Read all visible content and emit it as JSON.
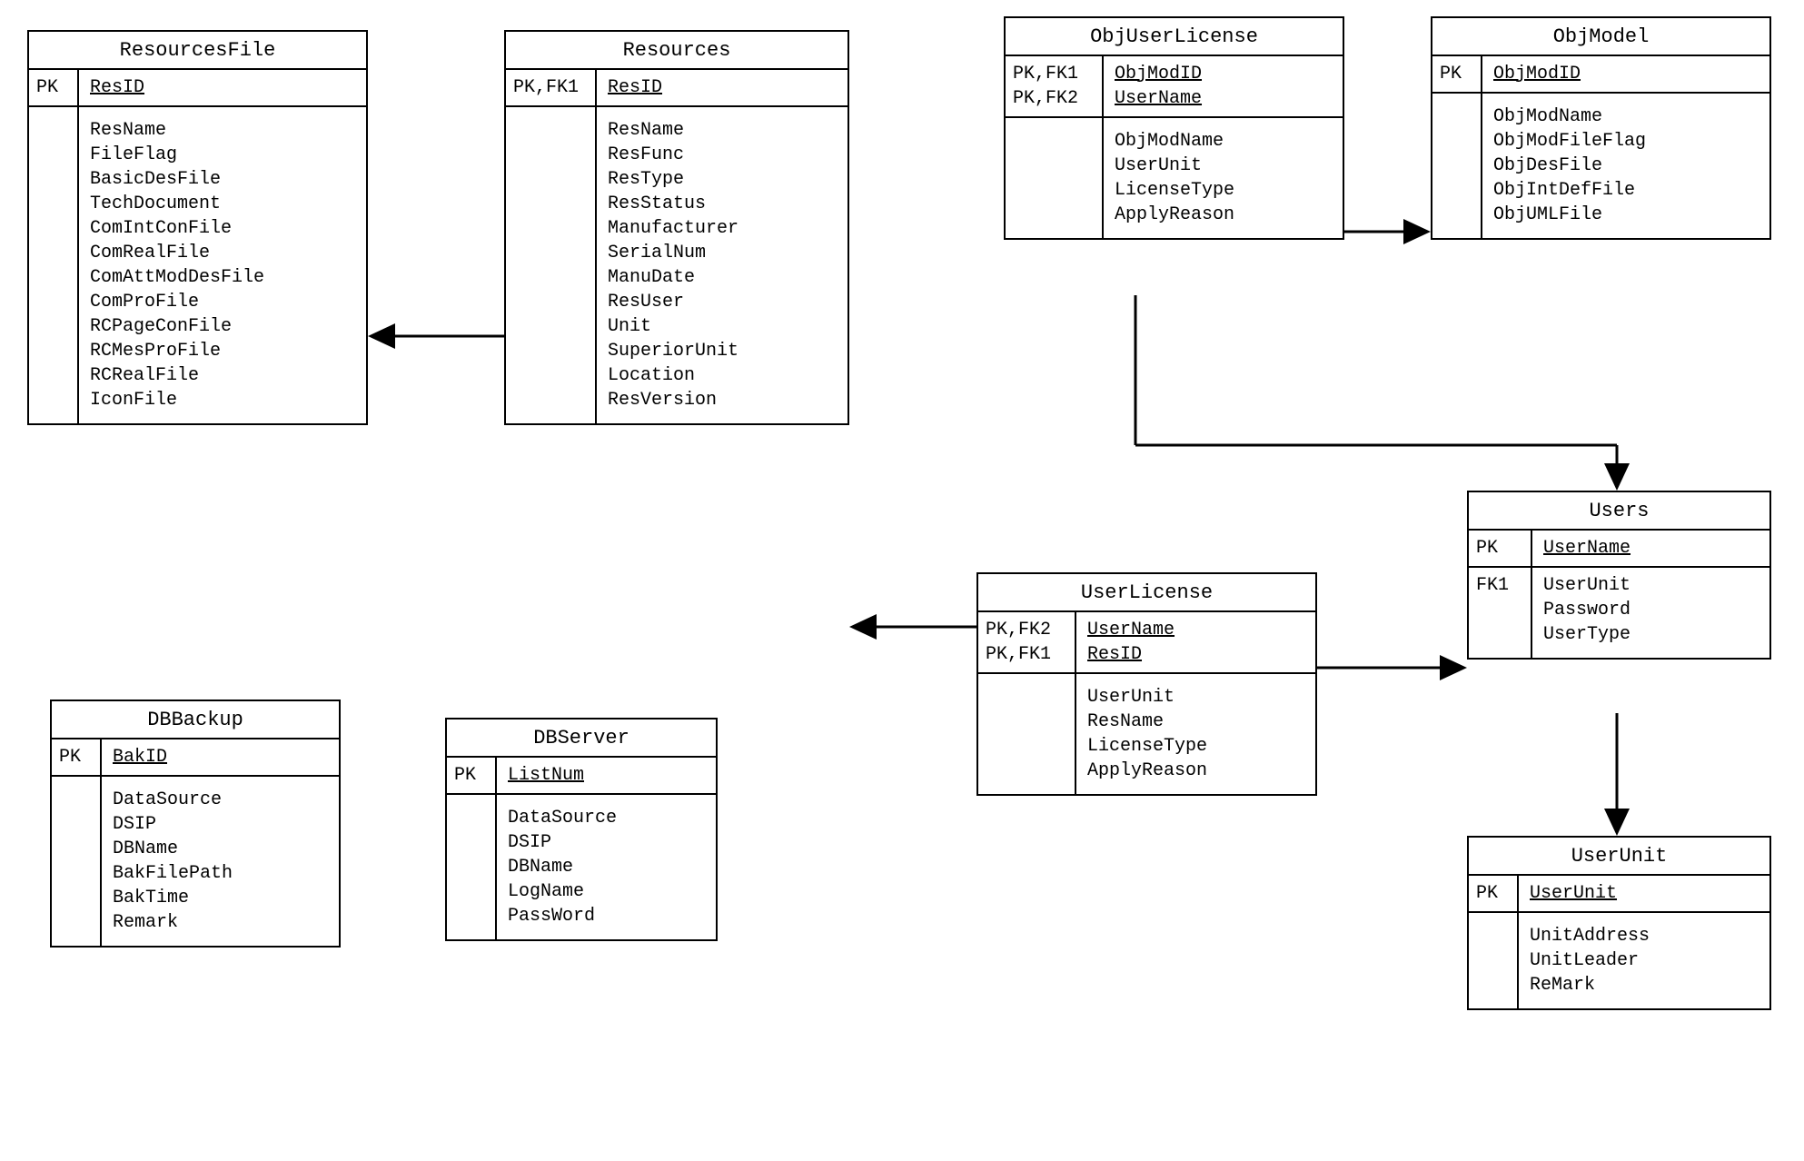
{
  "entities": {
    "ResourcesFile": {
      "title": "ResourcesFile",
      "pk_tags": [
        "PK"
      ],
      "pk_fields": [
        "ResID"
      ],
      "attrs": [
        "ResName",
        "FileFlag",
        "BasicDesFile",
        "TechDocument",
        "ComIntConFile",
        "ComRealFile",
        "ComAttModDesFile",
        "ComProFile",
        "RCPageConFile",
        "RCMesProFile",
        "RCRealFile",
        "IconFile"
      ]
    },
    "Resources": {
      "title": "Resources",
      "pk_tags": [
        "PK,FK1"
      ],
      "pk_fields": [
        "ResID"
      ],
      "attrs": [
        "ResName",
        "ResFunc",
        "ResType",
        "ResStatus",
        "Manufacturer",
        "SerialNum",
        "ManuDate",
        "ResUser",
        "Unit",
        "SuperiorUnit",
        "Location",
        "ResVersion"
      ]
    },
    "ObjUserLicense": {
      "title": "ObjUserLicense",
      "pk_tags": [
        "PK,FK1",
        "PK,FK2"
      ],
      "pk_fields": [
        "ObjModID",
        "UserName"
      ],
      "attrs": [
        "ObjModName",
        "UserUnit",
        "LicenseType",
        "ApplyReason"
      ]
    },
    "ObjModel": {
      "title": "ObjModel",
      "pk_tags": [
        "PK"
      ],
      "pk_fields": [
        "ObjModID"
      ],
      "attrs": [
        "ObjModName",
        "ObjModFileFlag",
        "ObjDesFile",
        "ObjIntDefFile",
        "ObjUMLFile"
      ]
    },
    "UserLicense": {
      "title": "UserLicense",
      "pk_tags": [
        "PK,FK2",
        "PK,FK1"
      ],
      "pk_fields": [
        "UserName",
        "ResID"
      ],
      "attrs": [
        "UserUnit",
        "ResName",
        "LicenseType",
        "ApplyReason"
      ]
    },
    "Users": {
      "title": "Users",
      "pk_tags": [
        "PK"
      ],
      "pk_fields": [
        "UserName"
      ],
      "fk_tags": [
        "FK1"
      ],
      "attrs": [
        "UserUnit",
        "Password",
        "UserType"
      ]
    },
    "UserUnit": {
      "title": "UserUnit",
      "pk_tags": [
        "PK"
      ],
      "pk_fields": [
        "UserUnit"
      ],
      "attrs": [
        "UnitAddress",
        "UnitLeader",
        "ReMark"
      ]
    },
    "DBBackup": {
      "title": "DBBackup",
      "pk_tags": [
        "PK"
      ],
      "pk_fields": [
        "BakID"
      ],
      "attrs": [
        "DataSource",
        "DSIP",
        "DBName",
        "BakFilePath",
        "BakTime",
        "Remark"
      ]
    },
    "DBServer": {
      "title": "DBServer",
      "pk_tags": [
        "PK"
      ],
      "pk_fields": [
        "ListNum"
      ],
      "attrs": [
        "DataSource",
        "DSIP",
        "DBName",
        "LogName",
        "PassWord"
      ]
    }
  },
  "relations": [
    {
      "from": "Resources",
      "to": "ResourcesFile"
    },
    {
      "from": "ObjUserLicense",
      "to": "ObjModel"
    },
    {
      "from": "ObjUserLicense",
      "to": "Users"
    },
    {
      "from": "UserLicense",
      "to": "Resources"
    },
    {
      "from": "UserLicense",
      "to": "Users"
    },
    {
      "from": "Users",
      "to": "UserUnit"
    }
  ]
}
